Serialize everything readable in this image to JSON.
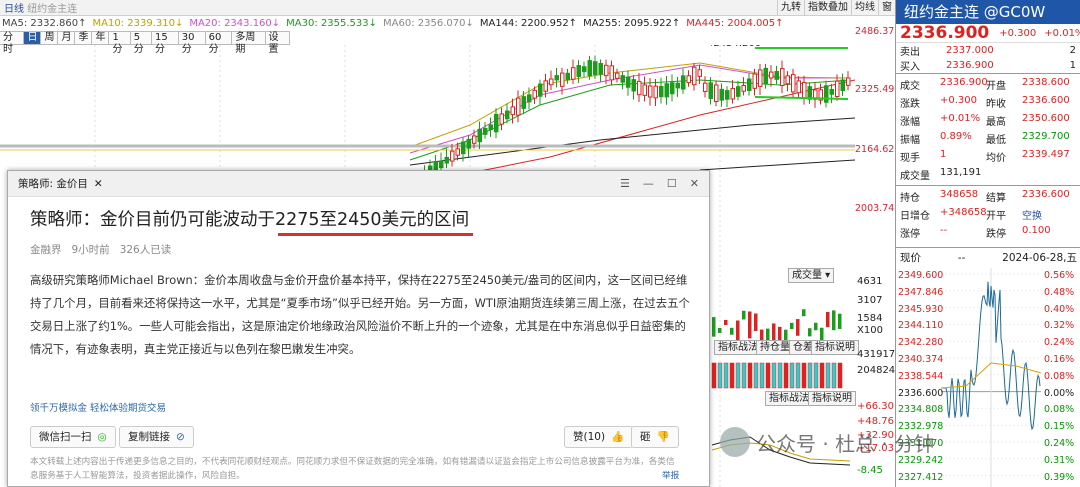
{
  "toolbar": {
    "title_prefix": "日线",
    "title": "纽约金主连",
    "tools": [
      "九转",
      "指数叠加",
      "均线",
      "窗"
    ]
  },
  "ma_row": [
    {
      "label": "MA5: 2332.860↑",
      "color": "#444"
    },
    {
      "label": "MA10: 2339.310↓",
      "color": "#c0a000"
    },
    {
      "label": "MA20: 2343.160↓",
      "color": "#d050d0"
    },
    {
      "label": "MA30: 2355.533↓",
      "color": "#1a9e1a"
    },
    {
      "label": "MA60: 2356.070↓",
      "color": "#888"
    },
    {
      "label": "MA144: 2200.952↑",
      "color": "#222"
    },
    {
      "label": "MA255: 2095.922↑",
      "color": "#222"
    },
    {
      "label": "MA445: 2004.005↑",
      "color": "#d22"
    }
  ],
  "period_tabs": [
    "分时",
    "日",
    "周",
    "月",
    "季",
    "年",
    "1分",
    "5分",
    "15分",
    "30分",
    "60分",
    "多周期",
    "设置"
  ],
  "period_active": 1,
  "price_axis": [
    "2486.375",
    "2325.498",
    "2164.622",
    "2003.745"
  ],
  "chart_annotations": {
    "high": "2454.200",
    "td_counts": [
      "7",
      "8",
      "9",
      "6",
      "7",
      "8",
      "9"
    ]
  },
  "sub_panels": {
    "vol_select": "成交量",
    "vol_axis": [
      "4631",
      "3107",
      "1584",
      "X100"
    ],
    "buttons1": [
      "指标战法",
      "持仓量",
      "仓差",
      "指标说明"
    ],
    "oi_axis": [
      "431917",
      "204824"
    ],
    "buttons2": [
      "指标战法",
      "指标说明"
    ],
    "macd_axis": [
      "+66.30",
      "+48.76",
      "+32.90",
      "+17.03",
      "-8.45"
    ]
  },
  "popup": {
    "tab": "策略师: 金价目",
    "headline": "策略师：金价目前仍可能波动于2275至2450美元的区间",
    "meta": [
      "金融界",
      "9小时前",
      "326人已读"
    ],
    "body": "高级研究策略师Michael Brown：金价本周收盘与金价开盘价基本持平，保持在2275至2450美元/盎司的区间内，这一区间已经维持了几个月，目前看来还将保持这一水平，尤其是“夏季市场”似乎已经开始。另一方面，WTI原油期货连续第三周上涨，在过去五个交易日上涨了约1%。一些人可能会指出，这是原油定价地缘政治风险溢价不断上升的一个迹象，尤其是在中东消息似乎日益密集的情况下，有迹象表明，真主党正接近与以色列在黎巴嫩发生冲突。",
    "link": "领千万模拟金 轻松体验期货交易",
    "share": "微信扫一扫",
    "copy": "复制链接",
    "like": "赞(10)",
    "brick": "砸",
    "disclaimer": "本文转载上述内容出于传递更多信息之目的，不代表同花顺财经观点。同花顺力求但不保证数据的完全准确，如有错漏请以证监会指定上市公司信息披露平台为准，各类信息服务基于人工智能算法，投资者据此操作，风险自担。",
    "report": "举报"
  },
  "quote": {
    "name": "纽约金主连 @GC0W",
    "price": "2336.900",
    "chg": "+0.300",
    "pct": "+0.01%",
    "sell": {
      "label": "卖出",
      "price": "2337.000",
      "vol": "2"
    },
    "buy": {
      "label": "买入",
      "price": "2336.900",
      "vol": "1"
    },
    "grid": [
      [
        "成交",
        "2336.900",
        "开盘",
        "2338.600"
      ],
      [
        "涨跌",
        "+0.300",
        "昨收",
        "2336.600"
      ],
      [
        "涨幅",
        "+0.01%",
        "最高",
        "2350.600"
      ],
      [
        "振幅",
        "0.89%",
        "最低",
        "2329.700"
      ],
      [
        "现手",
        "1",
        "均价",
        "2339.497"
      ],
      [
        "成交量",
        "131,191",
        "",
        ""
      ]
    ],
    "grid2": [
      [
        "持仓",
        "348658",
        "结算",
        "2336.600"
      ],
      [
        "日增仓",
        "+348658",
        "开平",
        "空换"
      ],
      [
        "涨停",
        "--",
        "跌停",
        "0.100"
      ]
    ],
    "now_label": "现价",
    "now_val": "--",
    "date": "2024-06-28,五"
  },
  "minute_axis": {
    "left": [
      "2349.600",
      "2347.846",
      "2345.930",
      "2344.110",
      "2342.280",
      "2340.374",
      "2338.544",
      "2336.600",
      "2334.808",
      "2332.978",
      "2331.070",
      "2329.242",
      "2327.412"
    ],
    "right": [
      "0.56%",
      "0.48%",
      "0.40%",
      "0.32%",
      "0.24%",
      "0.16%",
      "0.08%",
      "0.00%",
      "0.08%",
      "0.15%",
      "0.24%",
      "0.31%",
      "0.39%"
    ]
  },
  "watermark": "公众号 · 杜总 · 分钟"
}
